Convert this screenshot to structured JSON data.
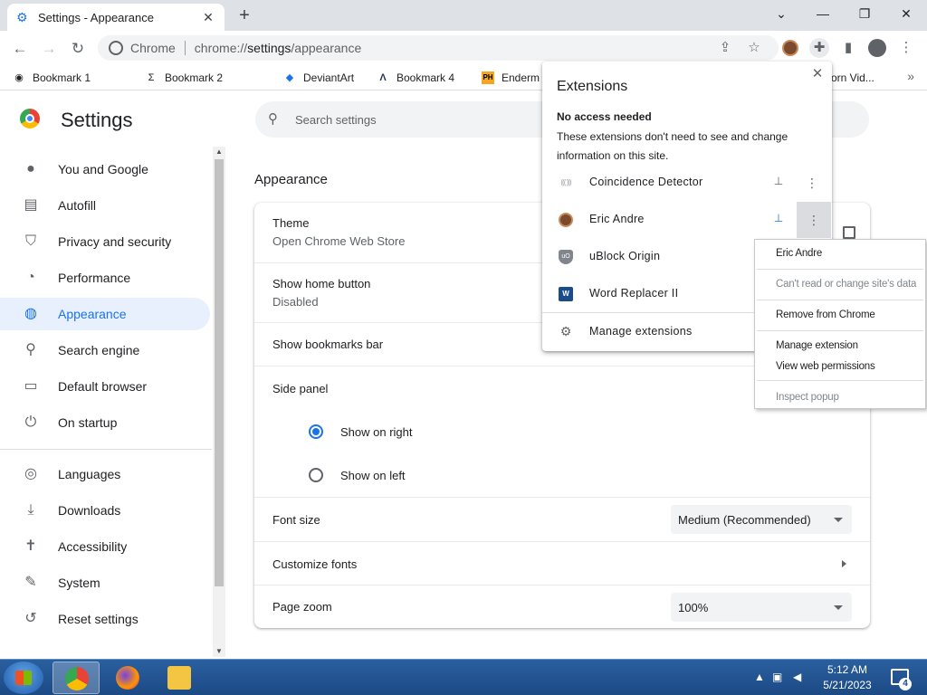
{
  "window": {
    "tab_title": "Settings - Appearance",
    "controls": {
      "minimize": "—",
      "restore": "❐",
      "close": "✕",
      "tab_list": "⌄"
    }
  },
  "toolbar": {
    "site_chip": "Chrome",
    "url_scheme": "chrome://",
    "url_host": "settings",
    "url_path": "/appearance"
  },
  "bookmarks": [
    {
      "label": "Bookmark 1",
      "icon": "globe-icon"
    },
    {
      "label": "Bookmark 2",
      "icon": "sigma-icon"
    },
    {
      "label": "DeviantArt",
      "icon": "deviantart-icon"
    },
    {
      "label": "Bookmark 4",
      "icon": "triangle-logo-icon"
    },
    {
      "label": "Enderm",
      "icon": "ph-logo-icon"
    },
    {
      "label": "orn Vid...",
      "icon": "bookmark-icon"
    }
  ],
  "settings": {
    "title": "Settings",
    "search_placeholder": "Search settings"
  },
  "sidebar": {
    "items": [
      {
        "label": "You and Google",
        "icon": "person-icon"
      },
      {
        "label": "Autofill",
        "icon": "clipboard-icon"
      },
      {
        "label": "Privacy and security",
        "icon": "shield-icon"
      },
      {
        "label": "Performance",
        "icon": "speedometer-icon"
      },
      {
        "label": "Appearance",
        "icon": "palette-icon",
        "selected": true
      },
      {
        "label": "Search engine",
        "icon": "search-icon"
      },
      {
        "label": "Default browser",
        "icon": "browser-window-icon"
      },
      {
        "label": "On startup",
        "icon": "power-icon"
      },
      {
        "label": "Languages",
        "icon": "globe-icon"
      },
      {
        "label": "Downloads",
        "icon": "download-icon"
      },
      {
        "label": "Accessibility",
        "icon": "accessibility-icon"
      },
      {
        "label": "System",
        "icon": "wrench-icon"
      },
      {
        "label": "Reset settings",
        "icon": "history-icon"
      }
    ]
  },
  "appearance": {
    "section_title": "Appearance",
    "theme_label": "Theme",
    "theme_sub": "Open Chrome Web Store",
    "home_button_label": "Show home button",
    "home_button_sub": "Disabled",
    "bookmarks_bar_label": "Show bookmarks bar",
    "side_panel_label": "Side panel",
    "side_panel_options": [
      {
        "label": "Show on right",
        "checked": true
      },
      {
        "label": "Show on left",
        "checked": false
      }
    ],
    "font_size_label": "Font size",
    "font_size_value": "Medium (Recommended)",
    "customize_fonts_label": "Customize fonts",
    "page_zoom_label": "Page zoom",
    "page_zoom_value": "100%"
  },
  "extensions_popup": {
    "title": "Extensions",
    "section_title": "No access needed",
    "section_desc": "These extensions don't need to see and change information on this site.",
    "items": [
      {
        "name": "Coincidence Detector",
        "icon": "coincidence-icon",
        "pinned": false
      },
      {
        "name": "Eric Andre",
        "icon": "eric-andre-avatar-icon",
        "pinned": true
      },
      {
        "name": "uBlock Origin",
        "icon": "ublock-shield-icon",
        "pinned": false
      },
      {
        "name": "Word Replacer II",
        "icon": "word-replacer-icon",
        "pinned": false
      }
    ],
    "manage_label": "Manage extensions"
  },
  "context_menu": {
    "items": [
      {
        "label": "Eric Andre",
        "disabled": false
      },
      {
        "label": "Can't read or change site's data",
        "disabled": true
      },
      {
        "label": "Remove from Chrome",
        "disabled": false
      },
      {
        "label": "Manage extension",
        "disabled": false
      },
      {
        "label": "View web permissions",
        "disabled": false
      },
      {
        "label": "Inspect popup",
        "disabled": true
      }
    ]
  },
  "taskbar": {
    "time": "5:12 AM",
    "date": "5/21/2023",
    "notification_count": "4"
  },
  "colors": {
    "accent": "#1a73e8",
    "selected_nav_bg": "#e8f0fe",
    "taskbar": "#1c4a85"
  }
}
